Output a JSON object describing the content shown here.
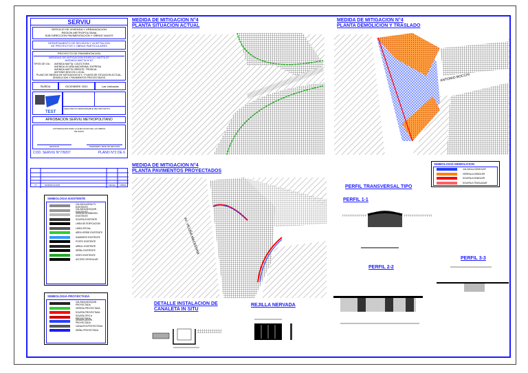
{
  "title_block": {
    "header": "SERVIU",
    "org_lines": [
      "SERVICIO DE VIVIENDA Y URBANIZACION",
      "REGION METROPOLITANA",
      "SUB DIRECCION PAVIMENTACION Y OBRAS VIALES"
    ],
    "dept_lines": [
      "DEPARTAMENTO DE REVISION Y ACEPTACION",
      "DE PROYECTOS Y OBRAS PARTICULARES"
    ],
    "project_header": "PROYECTO DE PAVIMENTACION",
    "project_name": [
      "MEDIDAS DE MITIGACION EDIFICIO MATTA 87",
      "AVENIDA MATTA N°87"
    ],
    "via_type_label": "TIPOS DE VIA :",
    "via_types": [
      "AVENIDA MATTA: COLECTORA",
      "AVENIDA VICUÑA MACKENNA: EXPRESA",
      "AVENIDA MATTA ORIENTE: TRONCAL",
      "ANTONIO BOCCHI: LOCAL"
    ],
    "plan_desc": [
      "PLANO DE MEDIDA DE MITIGACION N°4 : PLANTA DE SITUACION ACTUAL,",
      "DEMOLICION Y PAVIMENTOS PROYECTADOS"
    ],
    "comuna": "ÑUÑOA",
    "fecha": "DICIEMBRE 2020",
    "escala": "Las Indicadas",
    "firm_line": "ARQUITECTO RESPONSABLE DEL PROYECTO",
    "approval_header": "APROBACION SERVIU METROPOLITANO",
    "approval_text": [
      "AUTORIZACION PARA LA EJECUCION DE LAS OBRAS",
      "DE NUDO"
    ],
    "sign_left": "REVISOR",
    "sign_right": "INGENIERO JEFE DE SECCION",
    "cod": "COD. SERVIU N°7/9207",
    "plano": "PLANO N°2 DE 6"
  },
  "revisions": {
    "headers": [
      "N°",
      "MODIFICACION",
      "FECHA",
      "FIRMA"
    ]
  },
  "views": {
    "v1": [
      "MEDIDA DE MITIGACION N°4",
      "PLANTA SITUACION ACTUAL"
    ],
    "v2": [
      "MEDIDA DE MITIGACION N°4",
      "PLANTA DEMOLICION Y TRASLADO"
    ],
    "v3": [
      "MEDIDA DE MITIGACION N°4",
      "PLANTA PAVIMENTOS PROYECTADOS"
    ],
    "perfil_tipo": "PERFIL TRANSVERSAL TIPO",
    "p11": "PERFIL 1-1",
    "p22": "PERFIL 2-2",
    "p33": "PERFIL 3-3",
    "canaleta": [
      "DETALLE INSTALACION DE",
      "CANALETA IN SITU"
    ],
    "rejilla": "REJILLA NERVADA",
    "street_labels": [
      "ANTONIO BOCCHI",
      "AV. VICUÑA MACKENNA"
    ]
  },
  "legend_existente": {
    "title": "SIMBOLOGIA EXISTENTE",
    "items": [
      "CALZADA ASFALTO EXISTENTE",
      "CALZADA ADOQUIN EXISTENTE",
      "VEREDA HORMIGON EXISTENTE",
      "SOLERA EXISTENTE",
      "LINEA DE EDIFICACION",
      "LINEA OFICIAL",
      "AREA VERDE EXISTENTE",
      "SUMIDERO EXISTENTE",
      "POSTE EXISTENTE",
      "ARBOL EXISTENTE",
      "SEÑAL EXISTENTE",
      "GRIFO EXISTENTE",
      "ACCESO VEHICULAR"
    ]
  },
  "legend_proyectada": {
    "title": "SIMBOLOGIA PROYECTADA",
    "items": [
      "CALZADA ADOQUIN PROYECTADA",
      "VEREDA PROYECTADA",
      "SOLERA PROYECTADA",
      "SOLERA TIPO A PROYECTADA",
      "DEMARCACION PROYECTADA",
      "CANALETA PROYECTADA",
      "SEÑAL PROYECTADA"
    ]
  },
  "legend_demolicion": {
    "title": "SIMBOLOGIA DEMOLICION",
    "items": [
      "CALZADA A DEMOLER",
      "VEREDA A DEMOLER",
      "SOLERA A DEMOLER",
      "SOLERA A TRASLADAR"
    ],
    "colors": [
      "#2040ff",
      "#ff8000",
      "#ff0000",
      "#ff6060"
    ]
  }
}
